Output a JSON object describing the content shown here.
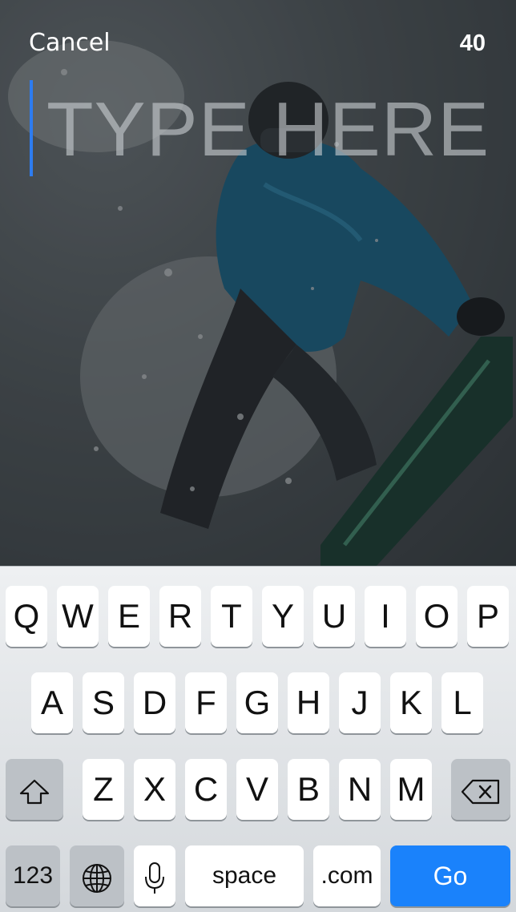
{
  "header": {
    "cancel_label": "Cancel",
    "char_count": "40"
  },
  "compose": {
    "placeholder": "TYPE HERE",
    "value": ""
  },
  "keyboard": {
    "row1": [
      "Q",
      "W",
      "E",
      "R",
      "T",
      "Y",
      "U",
      "I",
      "O",
      "P"
    ],
    "row2": [
      "A",
      "S",
      "D",
      "F",
      "G",
      "H",
      "J",
      "K",
      "L"
    ],
    "row3": [
      "Z",
      "X",
      "C",
      "V",
      "B",
      "N",
      "M"
    ],
    "shift_icon": "shift-arrow-icon",
    "delete_icon": "backspace-icon",
    "numbers_label": "123",
    "globe_icon": "globe-icon",
    "mic_icon": "microphone-icon",
    "space_label": "space",
    "dotcom_label": ".com",
    "go_label": "Go"
  },
  "colors": {
    "cursor": "#2d7cf0",
    "go_key": "#1a82fb",
    "keyboard_bg": "#dadde0"
  }
}
